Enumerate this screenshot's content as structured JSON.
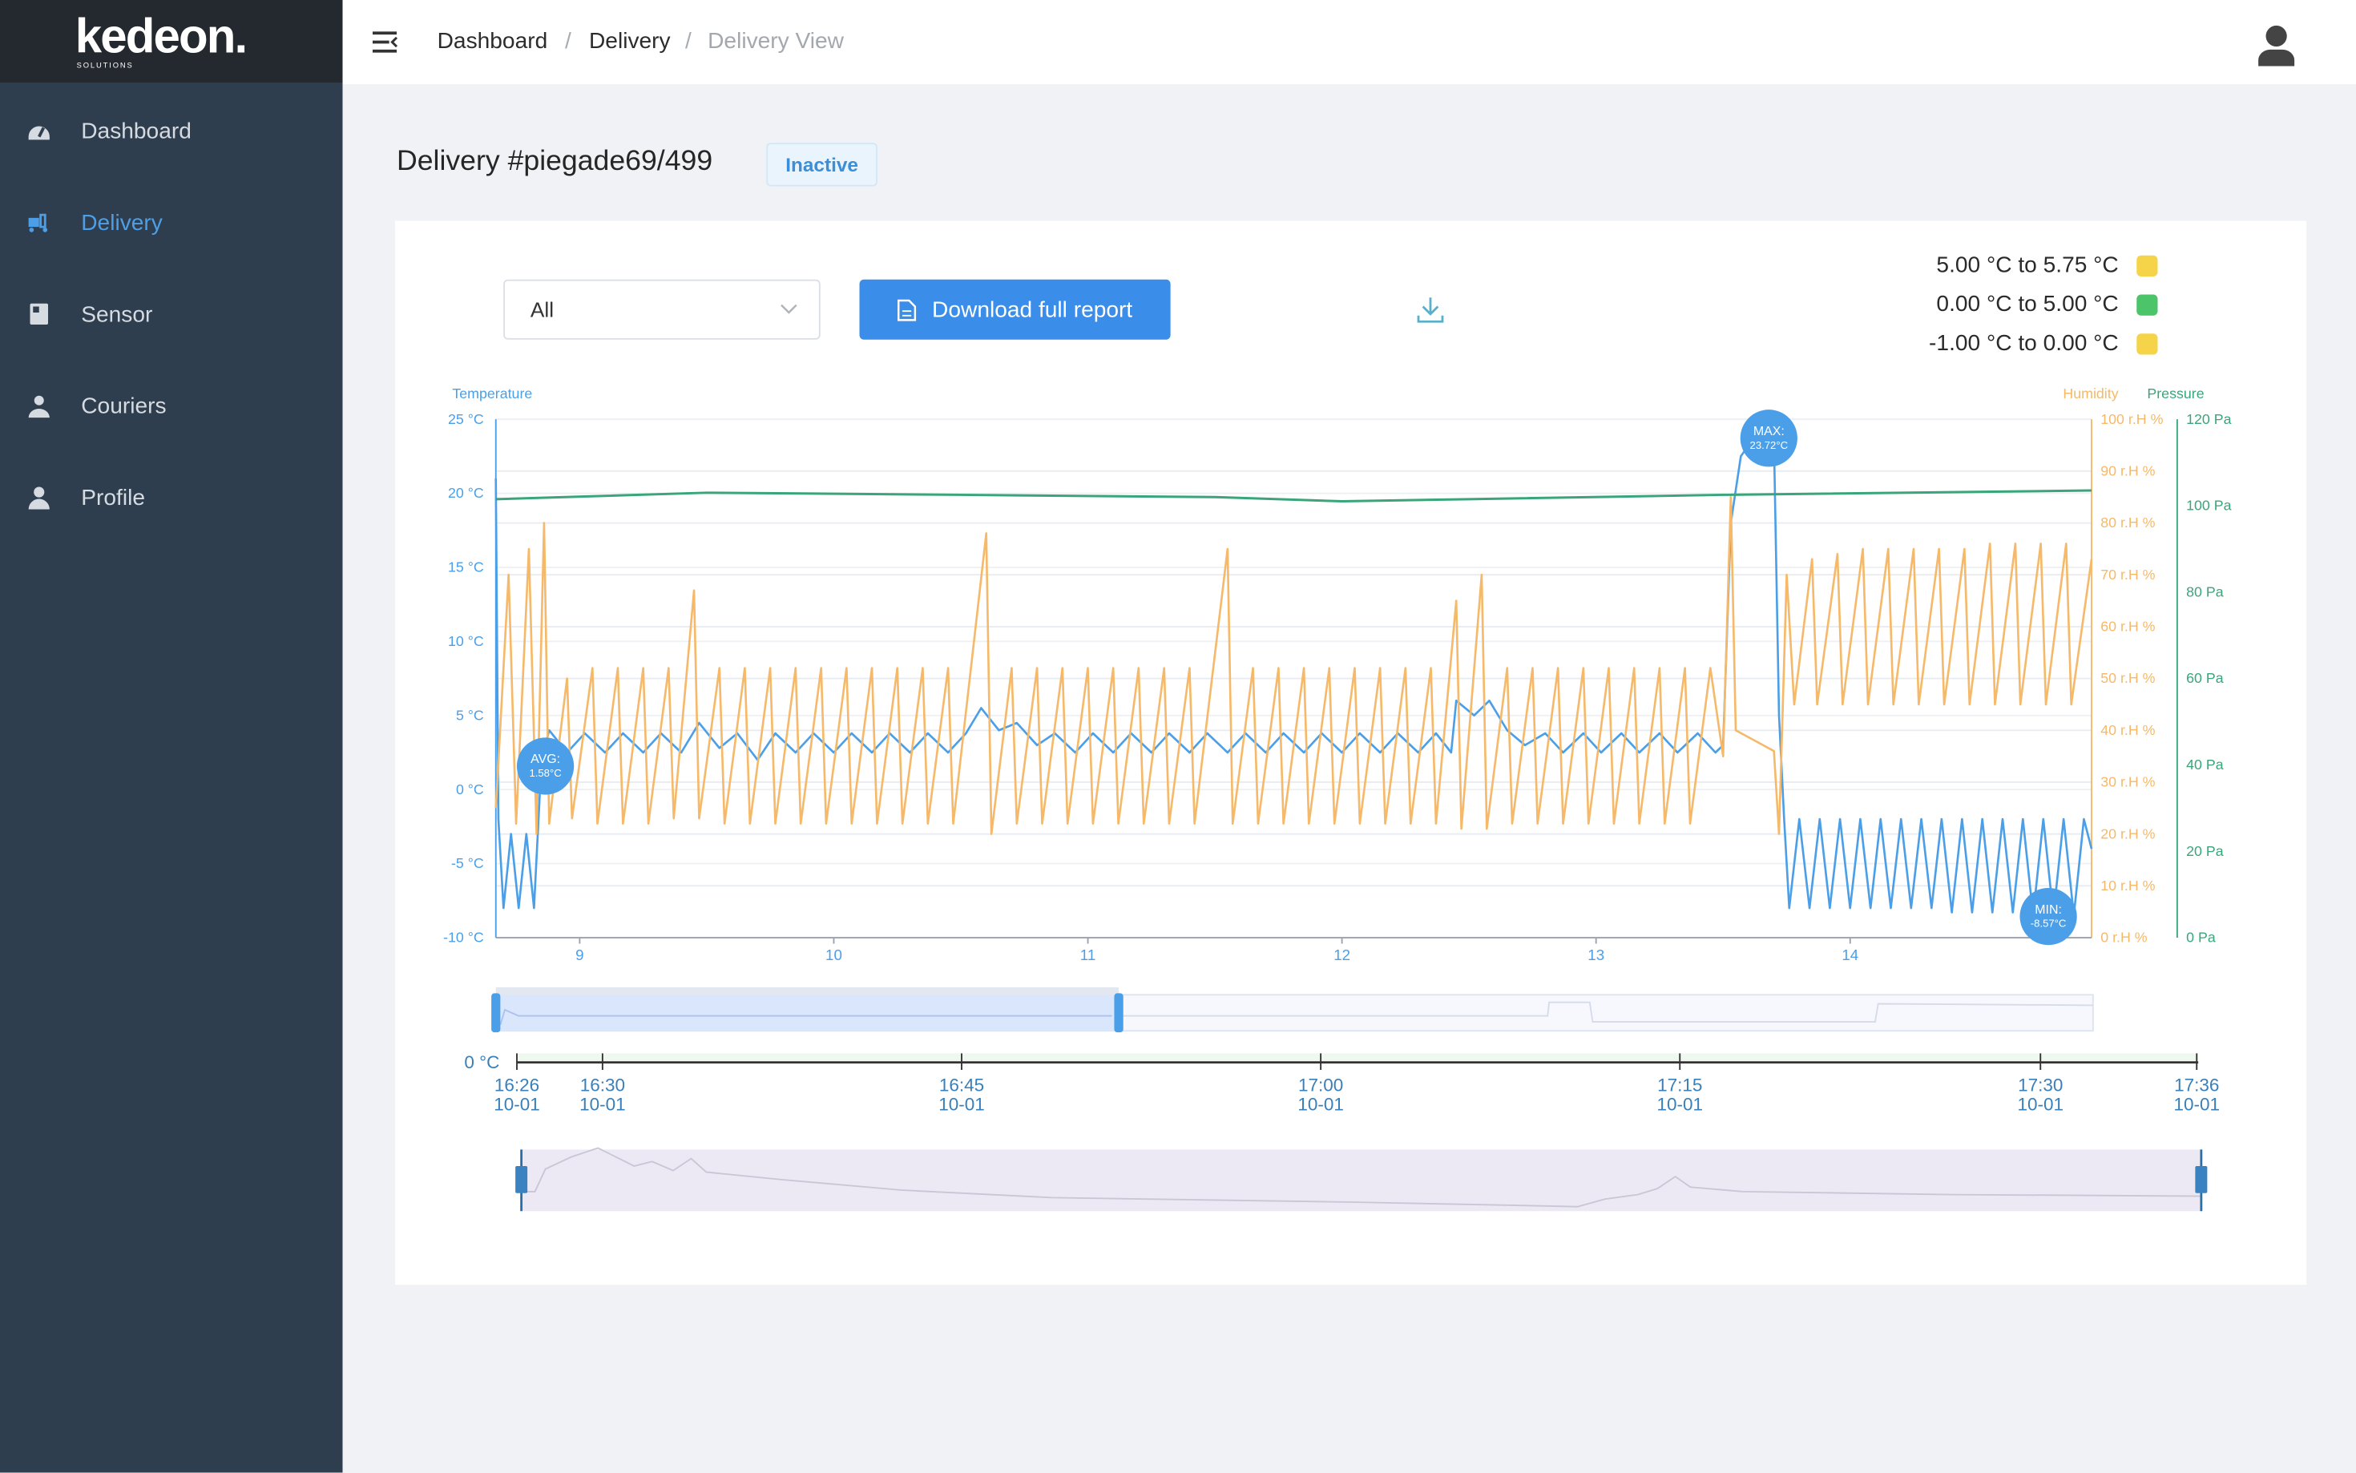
{
  "app": {
    "logo": "kedeon.",
    "logo_sub": "SOLUTIONS"
  },
  "sidebar": {
    "items": [
      {
        "label": "Dashboard",
        "icon": "dashboard-gauge-icon",
        "active": false
      },
      {
        "label": "Delivery",
        "icon": "delivery-truck-icon",
        "active": true
      },
      {
        "label": "Sensor",
        "icon": "sensor-icon",
        "active": false
      },
      {
        "label": "Couriers",
        "icon": "courier-icon",
        "active": false
      },
      {
        "label": "Profile",
        "icon": "profile-icon",
        "active": false
      }
    ]
  },
  "topbar": {
    "breadcrumb": [
      "Dashboard",
      "Delivery",
      "Delivery View"
    ],
    "separator": "/"
  },
  "page": {
    "title": "Delivery #piegade69/499",
    "status": "Inactive"
  },
  "controls": {
    "filter_value": "All",
    "download_label": "Download full report"
  },
  "legend": [
    {
      "label": "5.00 °C to 5.75 °C",
      "color": "#f5d44a"
    },
    {
      "label": "0.00 °C to 5.00 °C",
      "color": "#4cc46a"
    },
    {
      "label": "-1.00 °C to 0.00 °C",
      "color": "#f5d44a"
    }
  ],
  "colors": {
    "temperature": "#4a9fe8",
    "humidity": "#f5b969",
    "pressure": "#3aa57a",
    "accent": "#3a8de8"
  },
  "chart_data": {
    "type": "line",
    "axes": {
      "temperature": {
        "label": "Temperature",
        "range": [
          -10,
          25
        ],
        "ticks": [
          "25 °C",
          "20 °C",
          "15 °C",
          "10 °C",
          "5 °C",
          "0 °C",
          "-5 °C",
          "-10 °C"
        ]
      },
      "humidity": {
        "label": "Humidity",
        "range": [
          0,
          100
        ],
        "ticks": [
          "100 r.H %",
          "90 r.H %",
          "80 r.H %",
          "70 r.H %",
          "60 r.H %",
          "50 r.H %",
          "40 r.H %",
          "30 r.H %",
          "20 r.H %",
          "10 r.H %",
          "0 r.H %"
        ]
      },
      "pressure": {
        "label": "Pressure",
        "range": [
          0,
          120
        ],
        "ticks": [
          "120 Pa",
          "100 Pa",
          "80 Pa",
          "60 Pa",
          "40 Pa",
          "20 Pa",
          "0 Pa"
        ]
      },
      "x": {
        "range": [
          8.67,
          14.95
        ],
        "ticks": [
          "9",
          "10",
          "11",
          "12",
          "13",
          "14"
        ]
      }
    },
    "grid": true,
    "series": [
      {
        "key": "temperature",
        "points": [
          [
            8.67,
            21
          ],
          [
            8.68,
            -2
          ],
          [
            8.7,
            -8
          ],
          [
            8.73,
            -3
          ],
          [
            8.76,
            -8
          ],
          [
            8.79,
            -3
          ],
          [
            8.82,
            -8
          ],
          [
            8.85,
            2
          ],
          [
            8.88,
            4
          ],
          [
            8.95,
            2.5
          ],
          [
            9.02,
            3.8
          ],
          [
            9.1,
            2.5
          ],
          [
            9.17,
            3.8
          ],
          [
            9.25,
            2.5
          ],
          [
            9.32,
            3.8
          ],
          [
            9.4,
            2.5
          ],
          [
            9.47,
            4.5
          ],
          [
            9.55,
            2.8
          ],
          [
            9.62,
            3.8
          ],
          [
            9.7,
            2
          ],
          [
            9.77,
            3.8
          ],
          [
            9.85,
            2.5
          ],
          [
            9.92,
            3.8
          ],
          [
            10.0,
            2.5
          ],
          [
            10.07,
            3.8
          ],
          [
            10.15,
            2.5
          ],
          [
            10.22,
            3.8
          ],
          [
            10.3,
            2.5
          ],
          [
            10.37,
            3.8
          ],
          [
            10.45,
            2.5
          ],
          [
            10.52,
            3.8
          ],
          [
            10.58,
            5.5
          ],
          [
            10.65,
            4
          ],
          [
            10.72,
            4.5
          ],
          [
            10.8,
            3
          ],
          [
            10.87,
            3.8
          ],
          [
            10.95,
            2.5
          ],
          [
            11.02,
            3.8
          ],
          [
            11.1,
            2.5
          ],
          [
            11.17,
            3.8
          ],
          [
            11.25,
            2.5
          ],
          [
            11.32,
            3.8
          ],
          [
            11.4,
            2.5
          ],
          [
            11.47,
            3.8
          ],
          [
            11.55,
            2.5
          ],
          [
            11.62,
            3.8
          ],
          [
            11.7,
            2.5
          ],
          [
            11.77,
            3.8
          ],
          [
            11.85,
            2.5
          ],
          [
            11.92,
            3.8
          ],
          [
            12.0,
            2.5
          ],
          [
            12.07,
            3.8
          ],
          [
            12.15,
            2.5
          ],
          [
            12.22,
            3.8
          ],
          [
            12.3,
            2.5
          ],
          [
            12.37,
            3.8
          ],
          [
            12.43,
            2.5
          ],
          [
            12.45,
            6
          ],
          [
            12.52,
            5
          ],
          [
            12.58,
            6
          ],
          [
            12.65,
            4
          ],
          [
            12.72,
            3
          ],
          [
            12.8,
            3.8
          ],
          [
            12.87,
            2.5
          ],
          [
            12.95,
            3.8
          ],
          [
            13.02,
            2.5
          ],
          [
            13.1,
            3.8
          ],
          [
            13.17,
            2.5
          ],
          [
            13.25,
            3.8
          ],
          [
            13.32,
            2.5
          ],
          [
            13.4,
            3.8
          ],
          [
            13.47,
            2.5
          ],
          [
            13.5,
            3
          ],
          [
            13.53,
            18
          ],
          [
            13.57,
            22.5
          ],
          [
            13.62,
            23.7
          ],
          [
            13.7,
            23.7
          ],
          [
            13.72,
            5
          ],
          [
            13.74,
            -2
          ],
          [
            13.76,
            -8
          ],
          [
            13.8,
            -2
          ],
          [
            13.84,
            -8
          ],
          [
            13.88,
            -2
          ],
          [
            13.92,
            -8
          ],
          [
            13.96,
            -2
          ],
          [
            14.0,
            -8
          ],
          [
            14.04,
            -2
          ],
          [
            14.08,
            -8
          ],
          [
            14.12,
            -2
          ],
          [
            14.16,
            -8
          ],
          [
            14.2,
            -2
          ],
          [
            14.24,
            -8
          ],
          [
            14.28,
            -2
          ],
          [
            14.32,
            -8
          ],
          [
            14.36,
            -2
          ],
          [
            14.4,
            -8.3
          ],
          [
            14.44,
            -2
          ],
          [
            14.48,
            -8.3
          ],
          [
            14.52,
            -2
          ],
          [
            14.56,
            -8.3
          ],
          [
            14.6,
            -2
          ],
          [
            14.64,
            -8.3
          ],
          [
            14.68,
            -2
          ],
          [
            14.72,
            -8.5
          ],
          [
            14.76,
            -2
          ],
          [
            14.8,
            -8.5
          ],
          [
            14.84,
            -2
          ],
          [
            14.88,
            -8.5
          ],
          [
            14.92,
            -2
          ],
          [
            14.95,
            -4
          ]
        ]
      },
      {
        "key": "humidity",
        "points": [
          [
            8.67,
            25
          ],
          [
            8.72,
            70
          ],
          [
            8.75,
            22
          ],
          [
            8.8,
            75
          ],
          [
            8.83,
            20
          ],
          [
            8.86,
            80
          ],
          [
            8.88,
            22
          ],
          [
            8.95,
            50
          ],
          [
            8.97,
            23
          ],
          [
            9.05,
            52
          ],
          [
            9.07,
            22
          ],
          [
            9.15,
            52
          ],
          [
            9.17,
            22
          ],
          [
            9.25,
            52
          ],
          [
            9.27,
            22
          ],
          [
            9.35,
            52
          ],
          [
            9.37,
            23
          ],
          [
            9.45,
            67
          ],
          [
            9.47,
            23
          ],
          [
            9.55,
            52
          ],
          [
            9.57,
            22
          ],
          [
            9.65,
            52
          ],
          [
            9.67,
            22
          ],
          [
            9.75,
            52
          ],
          [
            9.77,
            22
          ],
          [
            9.85,
            52
          ],
          [
            9.87,
            22
          ],
          [
            9.95,
            52
          ],
          [
            9.97,
            22
          ],
          [
            10.05,
            52
          ],
          [
            10.07,
            22
          ],
          [
            10.15,
            52
          ],
          [
            10.17,
            22
          ],
          [
            10.25,
            52
          ],
          [
            10.27,
            22
          ],
          [
            10.35,
            52
          ],
          [
            10.37,
            22
          ],
          [
            10.45,
            52
          ],
          [
            10.47,
            22
          ],
          [
            10.6,
            78
          ],
          [
            10.62,
            20
          ],
          [
            10.7,
            52
          ],
          [
            10.72,
            22
          ],
          [
            10.8,
            52
          ],
          [
            10.82,
            22
          ],
          [
            10.9,
            52
          ],
          [
            10.92,
            22
          ],
          [
            11.0,
            52
          ],
          [
            11.02,
            22
          ],
          [
            11.1,
            52
          ],
          [
            11.12,
            22
          ],
          [
            11.2,
            52
          ],
          [
            11.22,
            22
          ],
          [
            11.3,
            52
          ],
          [
            11.32,
            22
          ],
          [
            11.4,
            52
          ],
          [
            11.42,
            22
          ],
          [
            11.55,
            75
          ],
          [
            11.57,
            22
          ],
          [
            11.65,
            52
          ],
          [
            11.67,
            22
          ],
          [
            11.75,
            52
          ],
          [
            11.77,
            22
          ],
          [
            11.85,
            52
          ],
          [
            11.87,
            22
          ],
          [
            11.95,
            52
          ],
          [
            11.97,
            22
          ],
          [
            12.05,
            52
          ],
          [
            12.07,
            22
          ],
          [
            12.15,
            52
          ],
          [
            12.17,
            22
          ],
          [
            12.25,
            52
          ],
          [
            12.27,
            22
          ],
          [
            12.35,
            52
          ],
          [
            12.37,
            22
          ],
          [
            12.45,
            65
          ],
          [
            12.47,
            21
          ],
          [
            12.55,
            70
          ],
          [
            12.57,
            21
          ],
          [
            12.65,
            52
          ],
          [
            12.67,
            22
          ],
          [
            12.75,
            52
          ],
          [
            12.77,
            22
          ],
          [
            12.85,
            52
          ],
          [
            12.87,
            22
          ],
          [
            12.95,
            52
          ],
          [
            12.97,
            22
          ],
          [
            13.05,
            52
          ],
          [
            13.07,
            22
          ],
          [
            13.15,
            52
          ],
          [
            13.17,
            22
          ],
          [
            13.25,
            52
          ],
          [
            13.27,
            22
          ],
          [
            13.35,
            52
          ],
          [
            13.37,
            22
          ],
          [
            13.45,
            52
          ],
          [
            13.5,
            35
          ],
          [
            13.53,
            85
          ],
          [
            13.55,
            40
          ],
          [
            13.7,
            36
          ],
          [
            13.72,
            20
          ],
          [
            13.75,
            70
          ],
          [
            13.78,
            45
          ],
          [
            13.85,
            73
          ],
          [
            13.87,
            45
          ],
          [
            13.95,
            74
          ],
          [
            13.97,
            45
          ],
          [
            14.05,
            75
          ],
          [
            14.07,
            45
          ],
          [
            14.15,
            75
          ],
          [
            14.17,
            45
          ],
          [
            14.25,
            75
          ],
          [
            14.27,
            45
          ],
          [
            14.35,
            75
          ],
          [
            14.37,
            45
          ],
          [
            14.45,
            75
          ],
          [
            14.47,
            45
          ],
          [
            14.55,
            76
          ],
          [
            14.57,
            45
          ],
          [
            14.65,
            76
          ],
          [
            14.67,
            45
          ],
          [
            14.75,
            76
          ],
          [
            14.77,
            45
          ],
          [
            14.85,
            76
          ],
          [
            14.87,
            45
          ],
          [
            14.95,
            73
          ]
        ]
      },
      {
        "key": "pressure",
        "points": [
          [
            8.67,
            101.5
          ],
          [
            9.5,
            103
          ],
          [
            10.5,
            102.5
          ],
          [
            11.5,
            102
          ],
          [
            12,
            101
          ],
          [
            12.5,
            101.5
          ],
          [
            13.5,
            102.5
          ],
          [
            14.95,
            103.5
          ]
        ]
      }
    ],
    "annotations": [
      {
        "label": "MAX:",
        "value": "23.72°C",
        "x": 13.68,
        "y": 23.72
      },
      {
        "label": "AVG:",
        "value": "1.58°C",
        "x": 8.865,
        "y": 1.58
      },
      {
        "label": "MIN:",
        "value": "-8.57°C",
        "x": 14.78,
        "y": -8.57
      }
    ]
  },
  "navigator": {
    "selected_fraction": [
      0,
      0.39
    ],
    "axis_label": "0 °C",
    "time_ticks": [
      {
        "time": "16:26",
        "date": "10-01"
      },
      {
        "time": "16:30",
        "date": "10-01"
      },
      {
        "time": "16:45",
        "date": "10-01"
      },
      {
        "time": "17:00",
        "date": "10-01"
      },
      {
        "time": "17:15",
        "date": "10-01"
      },
      {
        "time": "17:30",
        "date": "10-01"
      },
      {
        "time": "17:36",
        "date": "10-01"
      }
    ]
  }
}
